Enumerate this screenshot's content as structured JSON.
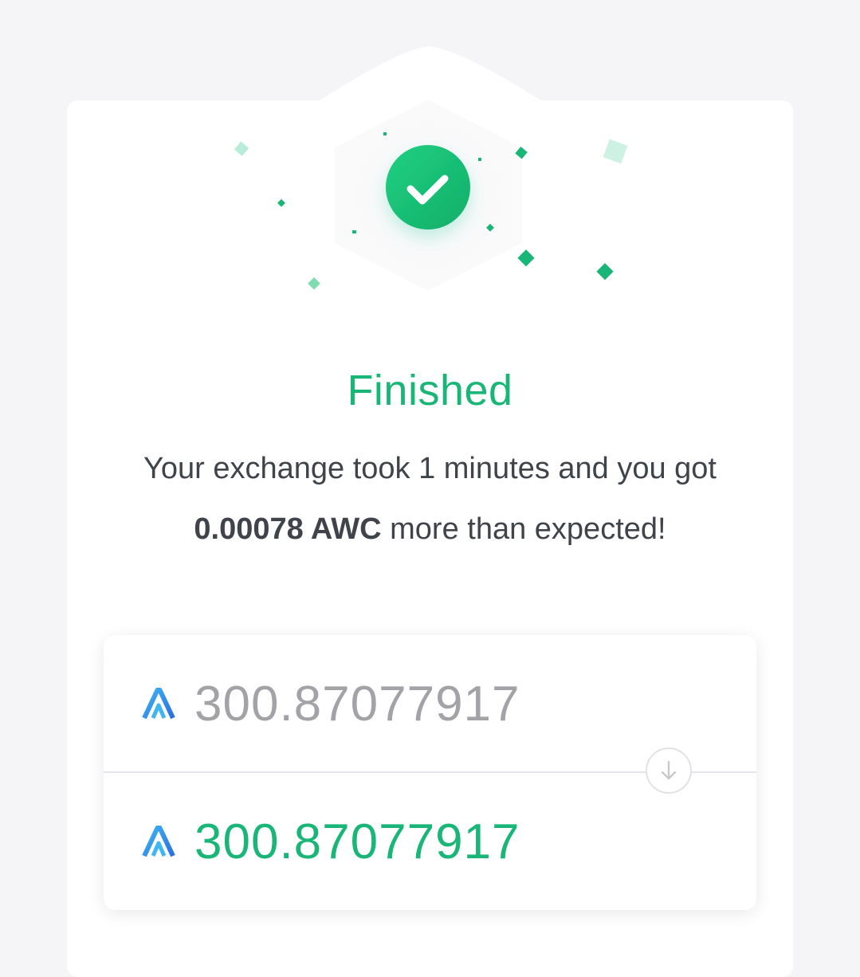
{
  "status": {
    "title": "Finished",
    "message_line1": "Your exchange took 1 minutes and you got",
    "bonus_amount": "0.00078 AWC",
    "message_line2_rest": " more than expected!",
    "icon": "check-circle-icon"
  },
  "exchange": {
    "from_amount": "300.87077917",
    "to_amount": "300.87077917",
    "coin_icon": "awc-coin-icon",
    "direction_icon": "arrow-down-icon"
  },
  "colors": {
    "success": "#19b677",
    "coin_blue": "#2f8ef0",
    "muted_text": "#a3a3a7",
    "body_text": "#3f434a"
  }
}
